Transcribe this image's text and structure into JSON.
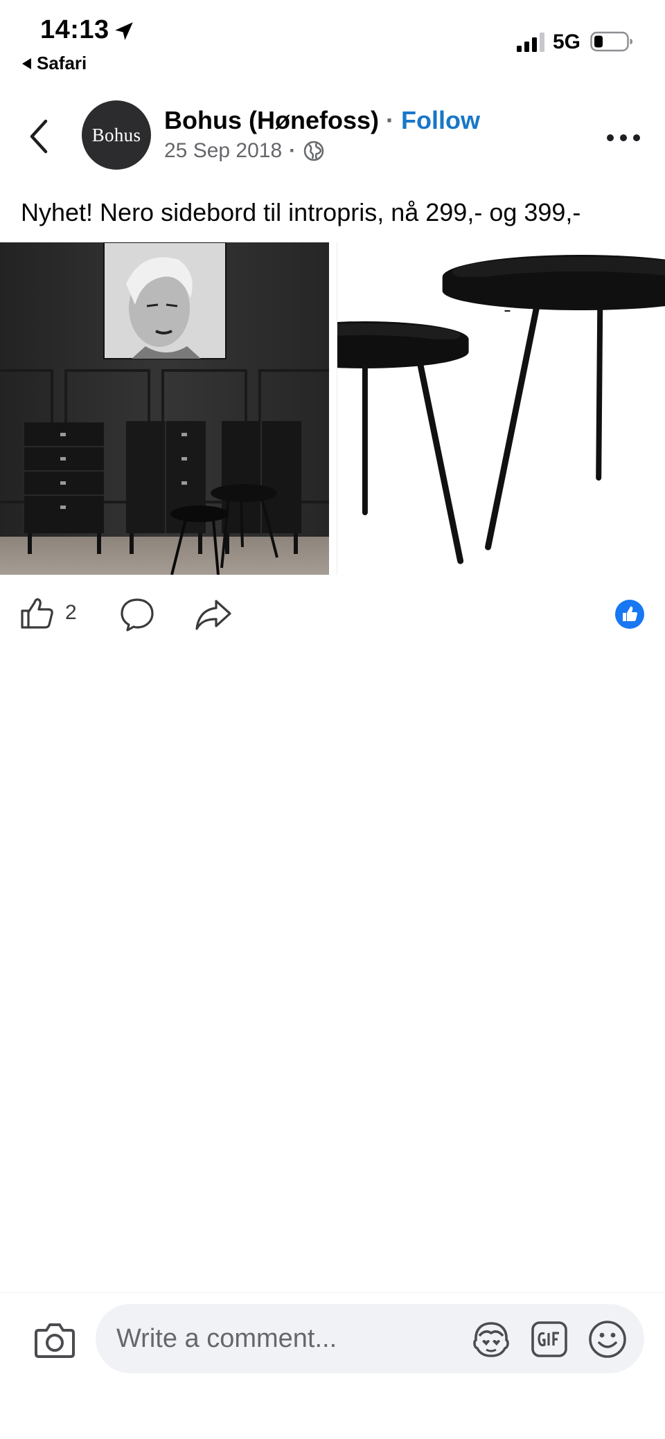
{
  "status_bar": {
    "time": "14:13",
    "back_app": "Safari",
    "network": "5G"
  },
  "post": {
    "page_name": "Bohus (Hønefoss)",
    "separator": "·",
    "follow_label": "Follow",
    "avatar_text": "Bohus",
    "date": "25 Sep 2018",
    "meta_separator": "·",
    "privacy_icon": "globe-icon",
    "text": "Nyhet! Nero sidebord til intropris, nå 299,- og 399,-"
  },
  "actions": {
    "like_count": "2",
    "reaction": "like"
  },
  "composer": {
    "placeholder": "Write a comment..."
  },
  "colors": {
    "follow": "#1877c8",
    "reaction_like": "#1877f2",
    "composer_bg": "#f0f2f5",
    "secondary_text": "#65676b"
  }
}
